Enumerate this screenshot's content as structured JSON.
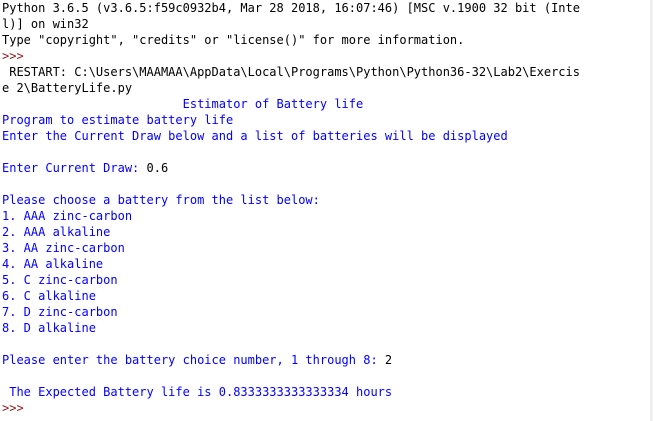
{
  "shell": {
    "lines": [
      {
        "kind": "std",
        "text": "Python 3.6.5 (v3.6.5:f59c0932b4, Mar 28 2018, 16:07:46) [MSC v.1900 32 bit (Inte"
      },
      {
        "kind": "std",
        "text": "l)] on win32"
      },
      {
        "kind": "std",
        "text": "Type \"copyright\", \"credits\" or \"license()\" for more information."
      },
      {
        "kind": "prompt",
        "text": ">>>"
      },
      {
        "kind": "std",
        "text": " RESTART: C:\\Users\\MAAMAA\\AppData\\Local\\Programs\\Python\\Python36-32\\Lab2\\Exercis"
      },
      {
        "kind": "std",
        "text": "e 2\\BatteryLife.py"
      },
      {
        "kind": "out",
        "text": "                         Estimator of Battery life"
      },
      {
        "kind": "out",
        "text": "Program to estimate battery life"
      },
      {
        "kind": "out",
        "text": "Enter the Current Draw below and a list of batteries will be displayed"
      },
      {
        "kind": "out",
        "text": ""
      },
      {
        "kind": "out",
        "text": "Enter Current Draw: ",
        "input": "0.6"
      },
      {
        "kind": "out",
        "text": ""
      },
      {
        "kind": "out",
        "text": "Please choose a battery from the list below:"
      },
      {
        "kind": "out",
        "text": "1. AAA zinc-carbon"
      },
      {
        "kind": "out",
        "text": "2. AAA alkaline"
      },
      {
        "kind": "out",
        "text": "3. AA zinc-carbon"
      },
      {
        "kind": "out",
        "text": "4. AA alkaline"
      },
      {
        "kind": "out",
        "text": "5. C zinc-carbon"
      },
      {
        "kind": "out",
        "text": "6. C alkaline"
      },
      {
        "kind": "out",
        "text": "7. D zinc-carbon"
      },
      {
        "kind": "out",
        "text": "8. D alkaline"
      },
      {
        "kind": "out",
        "text": ""
      },
      {
        "kind": "out",
        "text": "Please enter the battery choice number, 1 through 8: ",
        "input": "2"
      },
      {
        "kind": "out",
        "text": ""
      },
      {
        "kind": "out",
        "text": " The Expected Battery life is 0.8333333333333334 hours"
      },
      {
        "kind": "prompt",
        "text": ">>>"
      }
    ]
  },
  "colors": {
    "output": "#0000ff",
    "standard": "#000000",
    "prompt": "#8b1a1a",
    "background": "#ffffff"
  }
}
